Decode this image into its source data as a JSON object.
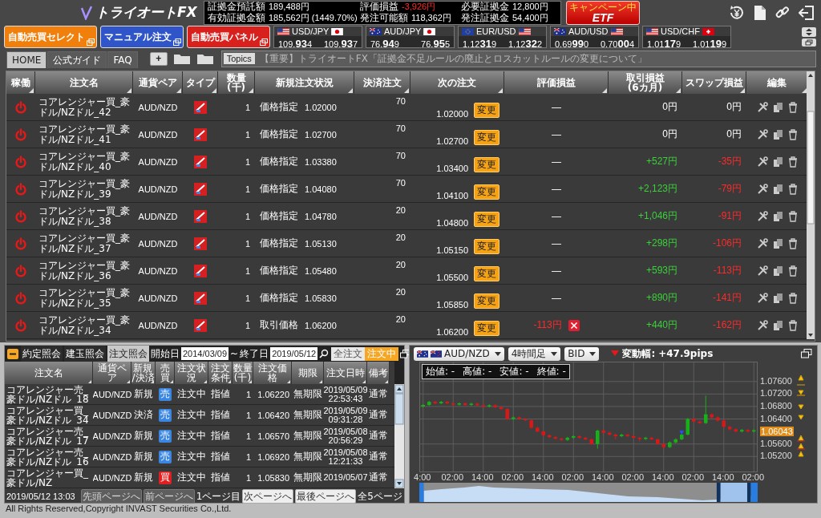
{
  "app": {
    "logo": "トライオートFX"
  },
  "account": [
    {
      "label": "証拠金預託額",
      "value": "189,488円",
      "kind": "plain"
    },
    {
      "label": "有効証拠金額",
      "value": "185,562円 (1449.70%)",
      "kind": "plain"
    },
    {
      "label": "評価損益",
      "value": "-3,926円",
      "kind": "loss"
    },
    {
      "label": "発注可能額",
      "value": "118,362円",
      "kind": "plain"
    },
    {
      "label": "必要証拠金",
      "value": "12,800円",
      "kind": "plain"
    },
    {
      "label": "発注証拠金",
      "value": "54,400円",
      "kind": "plain"
    }
  ],
  "etf_badge": {
    "caption": "キャンペーン中",
    "label": "ETF"
  },
  "mode_buttons": [
    {
      "label": "自動売買セレクト",
      "color": "#f07f0c"
    },
    {
      "label": "マニュアル注文",
      "color": "#2f55c8"
    },
    {
      "label": "自動売買パネル",
      "color": "#d8201c"
    }
  ],
  "rates": [
    {
      "pair": "USD/JPY",
      "bid": "109.934",
      "ask": "109.937"
    },
    {
      "pair": "AUD/JPY",
      "bid": "76.949",
      "ask": "76.955"
    },
    {
      "pair": "EUR/USD",
      "bid": "1.12319",
      "ask": "1.12322"
    },
    {
      "pair": "AUD/USD",
      "bid": "0.69990",
      "ask": "0.70004"
    },
    {
      "pair": "USD/CHF",
      "bid": "1.01179",
      "ask": "1.01199"
    }
  ],
  "tabs": [
    {
      "label": "HOME",
      "selected": true
    },
    {
      "label": "公式ガイド",
      "selected": false
    },
    {
      "label": "FAQ",
      "selected": false
    }
  ],
  "add_tab": "+",
  "topics": {
    "label": "Topics",
    "text": "【重要】トライオートFX「証拠金不足ルールの廃止とロスカットルールの変更について」"
  },
  "orders": {
    "columns": [
      "稼働",
      "注文名",
      "通貨ペア",
      "タイプ",
      "数量\n(千)",
      "新規注文状況",
      "決済注文",
      "次の注文",
      "評価損益",
      "取引損益\n(6カ月)",
      "スワップ損益",
      "編集"
    ],
    "rows": [
      {
        "running": true,
        "name": "コアレンジャー買_豪ドル/NZドル_42",
        "pair": "AUD/NZD",
        "quantity": "1",
        "entry_kind": "価格指定",
        "entry_price": "1.02000",
        "settle": "70",
        "next_price": "1.02000",
        "change": "変更",
        "evaluation": {
          "text": "—",
          "kind": "flat",
          "closable": false
        },
        "trade_pnl": {
          "text": "0円",
          "kind": "flat"
        },
        "swap_pnl": {
          "text": "0円",
          "kind": "flat"
        }
      },
      {
        "running": true,
        "name": "コアレンジャー買_豪ドル/NZドル_41",
        "pair": "AUD/NZD",
        "quantity": "1",
        "entry_kind": "価格指定",
        "entry_price": "1.02700",
        "settle": "70",
        "next_price": "1.02700",
        "change": "変更",
        "evaluation": {
          "text": "—",
          "kind": "flat",
          "closable": false
        },
        "trade_pnl": {
          "text": "0円",
          "kind": "flat"
        },
        "swap_pnl": {
          "text": "0円",
          "kind": "flat"
        }
      },
      {
        "running": true,
        "name": "コアレンジャー買_豪ドル/NZドル_40",
        "pair": "AUD/NZD",
        "quantity": "1",
        "entry_kind": "価格指定",
        "entry_price": "1.03380",
        "settle": "70",
        "next_price": "1.03400",
        "change": "変更",
        "evaluation": {
          "text": "—",
          "kind": "flat",
          "closable": false
        },
        "trade_pnl": {
          "text": "+527円",
          "kind": "gain"
        },
        "swap_pnl": {
          "text": "-35円",
          "kind": "loss"
        }
      },
      {
        "running": true,
        "name": "コアレンジャー買_豪ドル/NZドル_39",
        "pair": "AUD/NZD",
        "quantity": "1",
        "entry_kind": "価格指定",
        "entry_price": "1.04080",
        "settle": "70",
        "next_price": "1.04100",
        "change": "変更",
        "evaluation": {
          "text": "—",
          "kind": "flat",
          "closable": false
        },
        "trade_pnl": {
          "text": "+2,123円",
          "kind": "gain"
        },
        "swap_pnl": {
          "text": "-79円",
          "kind": "loss"
        }
      },
      {
        "running": true,
        "name": "コアレンジャー買_豪ドル/NZドル_38",
        "pair": "AUD/NZD",
        "quantity": "1",
        "entry_kind": "価格指定",
        "entry_price": "1.04780",
        "settle": "20",
        "next_price": "1.04800",
        "change": "変更",
        "evaluation": {
          "text": "—",
          "kind": "flat",
          "closable": false
        },
        "trade_pnl": {
          "text": "+1,046円",
          "kind": "gain"
        },
        "swap_pnl": {
          "text": "-91円",
          "kind": "loss"
        }
      },
      {
        "running": true,
        "name": "コアレンジャー買_豪ドル/NZドル_37",
        "pair": "AUD/NZD",
        "quantity": "1",
        "entry_kind": "価格指定",
        "entry_price": "1.05130",
        "settle": "20",
        "next_price": "1.05150",
        "change": "変更",
        "evaluation": {
          "text": "—",
          "kind": "flat",
          "closable": false
        },
        "trade_pnl": {
          "text": "+298円",
          "kind": "gain"
        },
        "swap_pnl": {
          "text": "-106円",
          "kind": "loss"
        }
      },
      {
        "running": true,
        "name": "コアレンジャー買_豪ドル/NZドル_36",
        "pair": "AUD/NZD",
        "quantity": "1",
        "entry_kind": "価格指定",
        "entry_price": "1.05480",
        "settle": "20",
        "next_price": "1.05500",
        "change": "変更",
        "evaluation": {
          "text": "—",
          "kind": "flat",
          "closable": false
        },
        "trade_pnl": {
          "text": "+593円",
          "kind": "gain"
        },
        "swap_pnl": {
          "text": "-113円",
          "kind": "loss"
        }
      },
      {
        "running": true,
        "name": "コアレンジャー買_豪ドル/NZドル_35",
        "pair": "AUD/NZD",
        "quantity": "1",
        "entry_kind": "価格指定",
        "entry_price": "1.05830",
        "settle": "20",
        "next_price": "1.05850",
        "change": "変更",
        "evaluation": {
          "text": "—",
          "kind": "flat",
          "closable": false
        },
        "trade_pnl": {
          "text": "+890円",
          "kind": "gain"
        },
        "swap_pnl": {
          "text": "-141円",
          "kind": "loss"
        }
      },
      {
        "running": true,
        "name": "コアレンジャー買_豪ドル/NZドル_34",
        "pair": "AUD/NZD",
        "quantity": "1",
        "entry_kind": "取引価格",
        "entry_price": "1.06200",
        "settle": "20",
        "next_price": "1.06200",
        "change": "変更",
        "evaluation": {
          "text": "-113円",
          "kind": "loss",
          "closable": true
        },
        "trade_pnl": {
          "text": "+440円",
          "kind": "gain"
        },
        "swap_pnl": {
          "text": "-162円",
          "kind": "loss"
        }
      }
    ]
  },
  "history": {
    "tabs": [
      {
        "label": "約定照会",
        "selected": false
      },
      {
        "label": "建玉照会",
        "selected": false
      },
      {
        "label": "注文照会",
        "selected": true
      }
    ],
    "start_label": "開始日",
    "start_date": "2014/03/09",
    "range_sep": "~",
    "end_label": "終了日",
    "end_date": "2019/05/12",
    "filters": [
      {
        "label": "全注文",
        "selected": false
      },
      {
        "label": "注文中",
        "selected": true
      }
    ],
    "columns": [
      "注文名",
      "通貨ペア",
      "新規\n/決済",
      "売買",
      "注文状況",
      "注文条件",
      "数量\n(千)",
      "注文価格",
      "期限",
      "注文日時",
      "備考"
    ],
    "rows": [
      {
        "name": "コアレンジャー売_豪ドル/NZドル_18",
        "pair": "AUD/NZD",
        "type": "新規",
        "side": "売",
        "color": "#3a86e0",
        "status": "注文中",
        "condition": "指値",
        "quantity": "1",
        "price": "1.06220",
        "expiry": "無期限",
        "date": "2019/05/09",
        "time": "22:53:43",
        "note": "通常"
      },
      {
        "name": "コアレンジャー買_豪ドル/NZドル_34",
        "pair": "AUD/NZD",
        "type": "決済",
        "side": "売",
        "color": "#3a86e0",
        "status": "注文中",
        "condition": "指値",
        "quantity": "1",
        "price": "1.06420",
        "expiry": "無期限",
        "date": "2019/05/09",
        "time": "09:31:28",
        "note": "通常"
      },
      {
        "name": "コアレンジャー売_豪ドル/NZドル_17",
        "pair": "AUD/NZD",
        "type": "新規",
        "side": "売",
        "color": "#3a86e0",
        "status": "注文中",
        "condition": "指値",
        "quantity": "1",
        "price": "1.06570",
        "expiry": "無期限",
        "date": "2019/05/08",
        "time": "20:56:29",
        "note": "通常"
      },
      {
        "name": "コアレンジャー売_豪ドル/NZドル_16",
        "pair": "AUD/NZD",
        "type": "新規",
        "side": "売",
        "color": "#3a86e0",
        "status": "注文中",
        "condition": "指値",
        "quantity": "1",
        "price": "1.06920",
        "expiry": "無期限",
        "date": "2019/05/08",
        "time": "12:21:33",
        "note": "通常"
      },
      {
        "name": "コアレンジャー買_豪ドル/NZ",
        "pair": "AUD/NZD",
        "type": "新規",
        "side": "買",
        "color": "#e02020",
        "status": "注文中",
        "condition": "指値",
        "quantity": "1",
        "price": "1.05830",
        "expiry": "無期限",
        "date": "2019/05/07",
        "note": "通常"
      }
    ],
    "updated": "2019/05/12 13:03",
    "pager": [
      {
        "label": "先頭ページへ",
        "disabled": true
      },
      {
        "label": "前ページへ",
        "disabled": true
      },
      {
        "label": "次ページへ",
        "disabled": false
      },
      {
        "label": "最後ページへ",
        "disabled": false
      }
    ],
    "page": "1ページ目",
    "total": "全5ページ"
  },
  "chart": {
    "pair": "AUD/NZD",
    "timeframe": "4時間足",
    "price_type": "BID",
    "range_label": "変動幅:",
    "range_value": "+47.9pips",
    "ohlc": [
      {
        "label": "始値:",
        "value": "-"
      },
      {
        "label": "高値:",
        "value": "-"
      },
      {
        "label": "安値:",
        "value": "-"
      },
      {
        "label": "終値:",
        "value": "-"
      }
    ],
    "chart_data": {
      "type": "candlestick",
      "categories": [
        "4:00",
        null,
        null,
        null,
        null,
        "02:00",
        null,
        null,
        null,
        null,
        "14:00",
        null,
        null,
        null,
        null,
        "02:00",
        null,
        null,
        null,
        null,
        "14:00",
        null,
        null,
        null,
        null,
        "02:00",
        null,
        null,
        null,
        null,
        "14:00",
        null,
        null,
        null,
        null,
        "02:00",
        null,
        null,
        null,
        null,
        "14:00",
        null,
        null,
        null,
        null,
        "02:00",
        null,
        null,
        null,
        null,
        "14:00",
        null,
        null,
        null,
        null,
        "02:00"
      ],
      "ohlc": [
        [
          1.068,
          1.0688,
          1.0677,
          1.0685
        ],
        [
          1.0685,
          1.0698,
          1.0682,
          1.0695
        ],
        [
          1.0695,
          1.0698,
          1.0687,
          1.069
        ],
        [
          1.069,
          1.0698,
          1.0687,
          1.0695
        ],
        [
          1.0695,
          1.0698,
          1.0687,
          1.069
        ],
        [
          1.069,
          1.0693,
          1.0683,
          1.0686
        ],
        [
          1.0686,
          1.0693,
          1.0683,
          1.069
        ],
        [
          1.069,
          1.0693,
          1.0682,
          1.0685
        ],
        [
          1.0685,
          1.0692,
          1.0682,
          1.0689
        ],
        [
          1.0689,
          1.0692,
          1.0681,
          1.0684
        ],
        [
          1.0684,
          1.0687,
          1.0677,
          1.068
        ],
        [
          1.068,
          1.0687,
          1.0677,
          1.0684
        ],
        [
          1.0684,
          1.0687,
          1.0675,
          1.0678
        ],
        [
          1.0678,
          1.0681,
          1.0669,
          1.0672
        ],
        [
          1.0672,
          1.0675,
          1.0637,
          1.064
        ],
        [
          1.064,
          1.0648,
          1.0637,
          1.0645
        ],
        [
          1.0645,
          1.0648,
          1.0637,
          1.064
        ],
        [
          1.064,
          1.0643,
          1.0633,
          1.0636
        ],
        [
          1.0636,
          1.0639,
          1.0609,
          1.0612
        ],
        [
          1.0612,
          1.0615,
          1.0597,
          1.06
        ],
        [
          1.06,
          1.0603,
          1.0585,
          1.0588
        ],
        [
          1.0588,
          1.0591,
          1.0579,
          1.0582
        ],
        [
          1.0582,
          1.0585,
          1.0574,
          1.0577
        ],
        [
          1.0577,
          1.058,
          1.057,
          1.0573
        ],
        [
          1.0573,
          1.0583,
          1.057,
          1.058
        ],
        [
          1.058,
          1.0588,
          1.0577,
          1.0585
        ],
        [
          1.0585,
          1.0588,
          1.0577,
          1.058
        ],
        [
          1.058,
          1.0583,
          1.0572,
          1.0575
        ],
        [
          1.0575,
          1.0578,
          1.0557,
          1.056
        ],
        [
          1.056,
          1.0606,
          1.0545,
          1.0603
        ],
        [
          1.0603,
          1.0606,
          1.0593,
          1.0596
        ],
        [
          1.0596,
          1.0599,
          1.0587,
          1.059
        ],
        [
          1.059,
          1.0593,
          1.0575,
          1.0585
        ],
        [
          1.0585,
          1.0593,
          1.0582,
          1.059
        ],
        [
          1.059,
          1.0593,
          1.0582,
          1.0585
        ],
        [
          1.0585,
          1.0588,
          1.0577,
          1.058
        ],
        [
          1.058,
          1.0583,
          1.0568,
          1.0576
        ],
        [
          1.0576,
          1.0583,
          1.0573,
          1.058
        ],
        [
          1.058,
          1.0583,
          1.0572,
          1.0575
        ],
        [
          1.0575,
          1.0578,
          1.0557,
          1.056
        ],
        [
          1.056,
          1.0563,
          1.0547,
          1.055
        ],
        [
          1.055,
          1.0568,
          1.0547,
          1.0565
        ],
        [
          1.0565,
          1.0578,
          1.0562,
          1.0575
        ],
        [
          1.0575,
          1.0593,
          1.0572,
          1.059
        ],
        [
          1.059,
          1.0643,
          1.0587,
          1.064
        ],
        [
          1.064,
          1.0643,
          1.0629,
          1.0632
        ],
        [
          1.0632,
          1.0635,
          1.0624,
          1.0627
        ],
        [
          1.0627,
          1.0715,
          1.0624,
          1.0655
        ],
        [
          1.0655,
          1.0658,
          1.0642,
          1.0645
        ],
        [
          1.0645,
          1.0648,
          1.0632,
          1.0635
        ],
        [
          1.0635,
          1.0638,
          1.0612,
          1.0615
        ],
        [
          1.0615,
          1.0618,
          1.0604,
          1.0607
        ],
        [
          1.0607,
          1.061,
          1.0597,
          1.06
        ],
        [
          1.06,
          1.0608,
          1.0597,
          1.0605
        ],
        [
          1.0605,
          1.0608,
          1.0597,
          1.06
        ],
        [
          1.06,
          1.0607,
          1.0597,
          1.0604
        ]
      ],
      "ylim": [
        1.0472,
        1.0821
      ],
      "grid": true,
      "yticks": [
        {
          "value": 1.076,
          "label": "1.07600"
        },
        {
          "value": 1.072,
          "label": "1.07200"
        },
        {
          "value": 1.068,
          "label": "1.06800"
        },
        {
          "value": 1.064,
          "label": "1.06400"
        },
        {
          "value": 1.056,
          "label": "1.05600"
        },
        {
          "value": 1.052,
          "label": "1.05200"
        }
      ]
    },
    "current_price": "1.06043"
  },
  "footer": "All Rights Reserved,Copyright INVAST Securities Co.,Ltd."
}
